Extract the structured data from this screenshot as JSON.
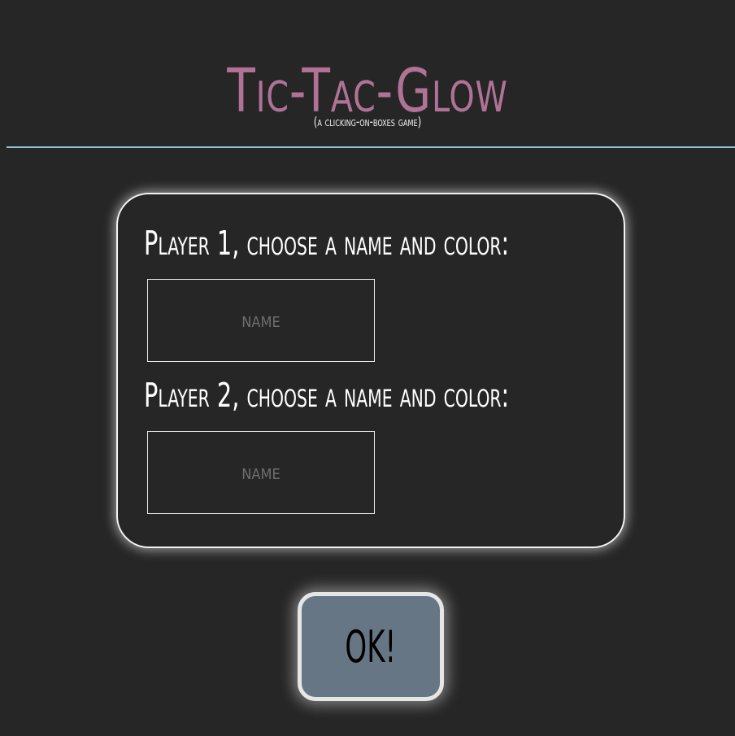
{
  "header": {
    "title": "Tic-Tac-Glow",
    "subtitle": "(a clicking-on-boxes game)"
  },
  "setup_panel": {
    "player1": {
      "prompt": "Player 1, choose a name and color:",
      "name_input": {
        "value": "",
        "placeholder": "name"
      }
    },
    "player2": {
      "prompt": "Player 2, choose a name and color:",
      "name_input": {
        "value": "",
        "placeholder": "name"
      }
    }
  },
  "actions": {
    "ok_label": "OK!"
  },
  "colors": {
    "background": "#262626",
    "title": "#b07396",
    "divider": "#8fc4dc",
    "button_fill": "#677685",
    "glow": "#ffffff"
  }
}
